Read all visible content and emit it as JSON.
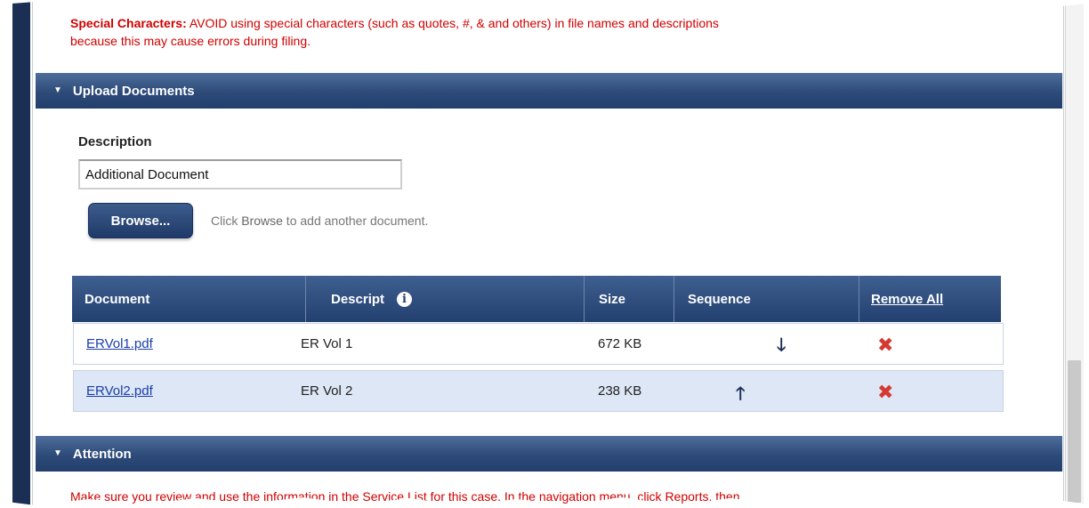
{
  "special_note": {
    "label": "Special Characters:",
    "text": "AVOID using special characters (such as quotes, #, & and others) in file names and descriptions",
    "text2": "because this may cause errors during filing."
  },
  "upload_section": {
    "title": "Upload Documents",
    "description_label": "Description",
    "description_value": "Additional Document",
    "browse_label": "Browse...",
    "hint_prefix": "Click ",
    "hint_bold": "Browse",
    "hint_suffix": " to add another document."
  },
  "table": {
    "headers": {
      "document": "Document",
      "description": "Descript",
      "size": "Size",
      "sequence": "Sequence",
      "remove_all": "Remove All"
    },
    "rows": [
      {
        "document": "ERVol1.pdf",
        "description": "ER Vol 1",
        "size": "672 KB",
        "sequence_icon": "arrow-down-icon"
      },
      {
        "document": "ERVol2.pdf",
        "description": "ER Vol 2",
        "size": "238 KB",
        "sequence_icon": "arrow-up-icon"
      }
    ]
  },
  "attention_section": {
    "title": "Attention",
    "text": "Make sure you review and use the information in the Service List for this case. In the navigation menu, click Reports, then"
  },
  "colors": {
    "header_blue": "#2d4a78",
    "warning_red": "#d00000",
    "link_blue": "#1a3ea8",
    "row_alt": "#dde7f5",
    "remove_red": "#d43a32"
  }
}
